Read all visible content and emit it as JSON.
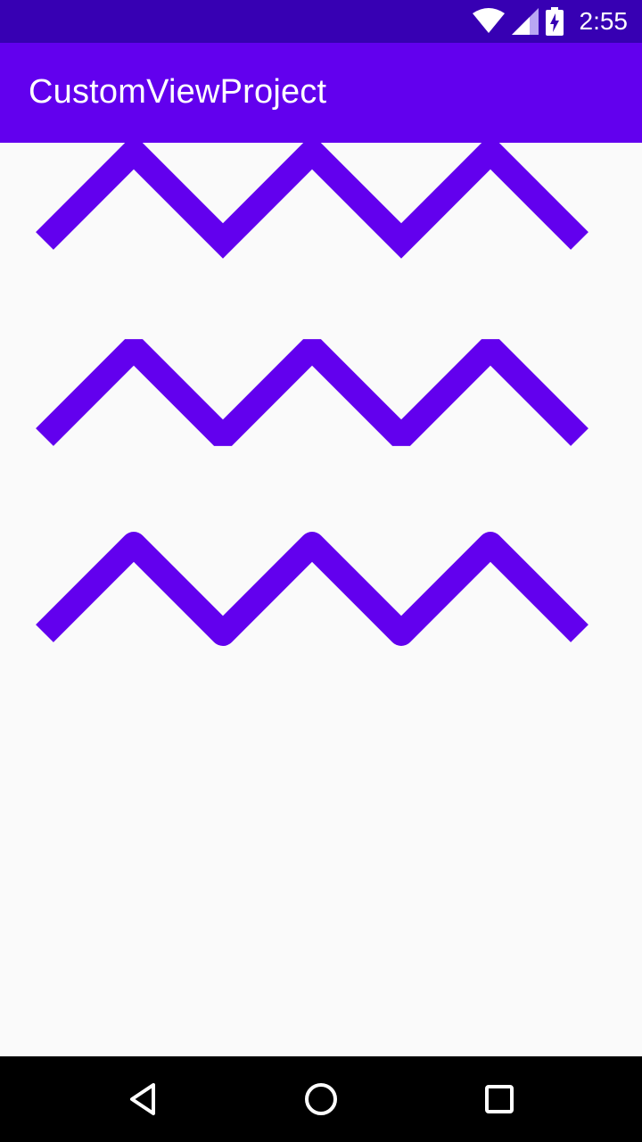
{
  "status_bar": {
    "time": "2:55",
    "icons": [
      "wifi-icon",
      "cell-signal-icon",
      "battery-charging-icon"
    ]
  },
  "app_bar": {
    "title": "CustomViewProject"
  },
  "zigzags": [
    {
      "style": "miter-join-butt-cap"
    },
    {
      "style": "bevel-join-butt-cap"
    },
    {
      "style": "round-join-butt-cap"
    }
  ],
  "colors": {
    "status_bar": "#3700b3",
    "app_bar": "#6200ee",
    "stroke": "#6200ee",
    "background": "#fafafa",
    "nav_bar": "#000000"
  },
  "nav_bar": {
    "icons": [
      "back-icon",
      "home-icon",
      "recents-icon"
    ]
  }
}
